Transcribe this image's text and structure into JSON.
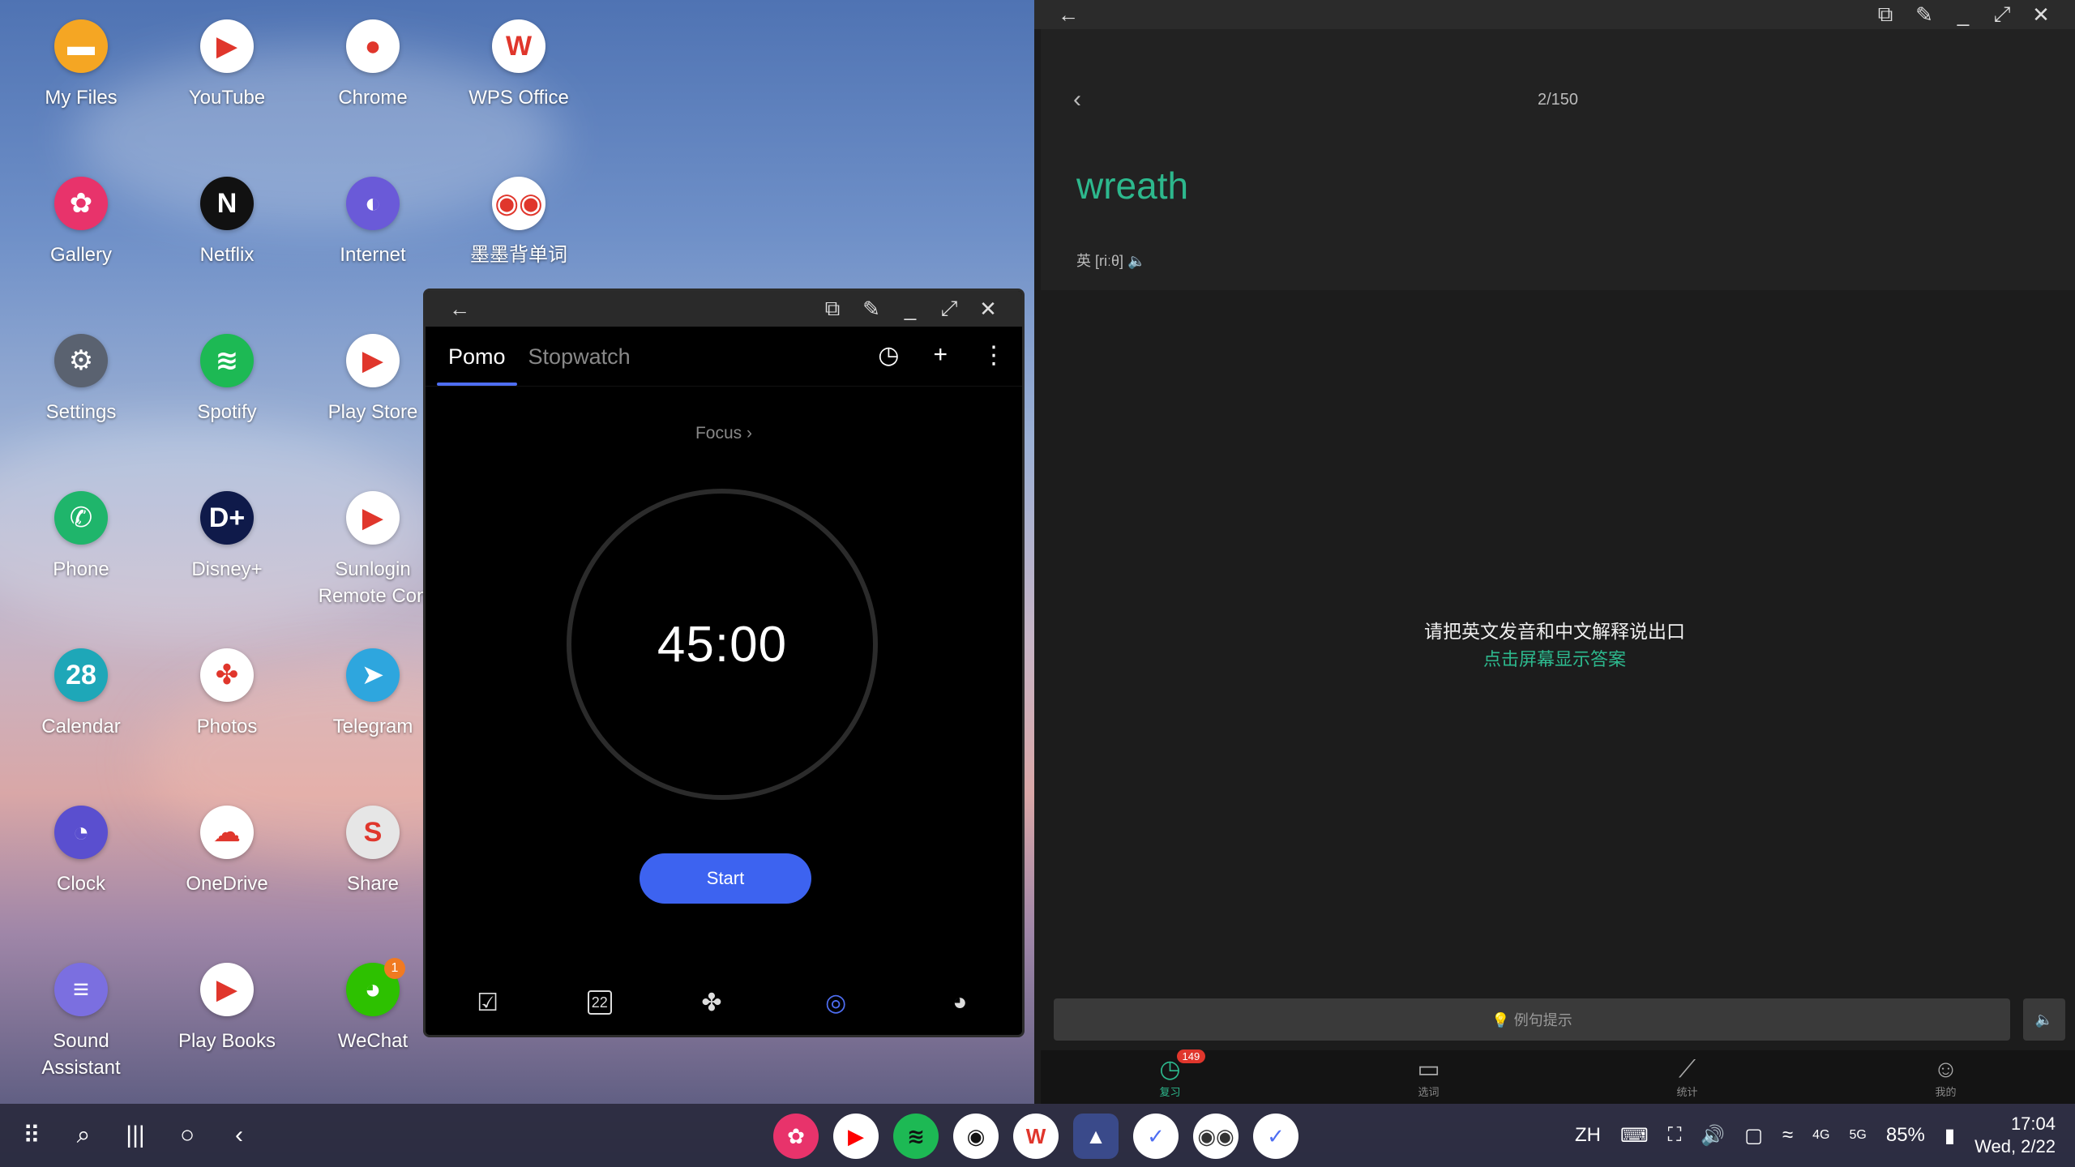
{
  "desktop": {
    "apps": [
      {
        "label": "My Files",
        "glyph": "▬",
        "bg": "#f5a623"
      },
      {
        "label": "YouTube",
        "glyph": "▶",
        "bg": "#ffffff"
      },
      {
        "label": "Chrome",
        "glyph": "●",
        "bg": "#ffffff"
      },
      {
        "label": "WPS Office",
        "glyph": "W",
        "bg": "#ffffff"
      },
      {
        "label": "Gallery",
        "glyph": "✿",
        "bg": "#e8336b"
      },
      {
        "label": "Netflix",
        "glyph": "N",
        "bg": "#111111"
      },
      {
        "label": "Internet",
        "glyph": "◐",
        "bg": "#6a5ad8"
      },
      {
        "label": "墨墨背单词",
        "glyph": "◉◉",
        "bg": "#ffffff"
      },
      {
        "label": "Settings",
        "glyph": "⚙",
        "bg": "#5a6270"
      },
      {
        "label": "Spotify",
        "glyph": "≋",
        "bg": "#1db954"
      },
      {
        "label": "Play Store",
        "glyph": "▶",
        "bg": "#ffffff"
      },
      {
        "label": "Phone",
        "glyph": "✆",
        "bg": "#1fb56b"
      },
      {
        "label": "Disney+",
        "glyph": "D+",
        "bg": "#0f1a4a"
      },
      {
        "label": "Sunlogin\nRemote Con",
        "glyph": "▶",
        "bg": "#ffffff"
      },
      {
        "label": "Calendar",
        "glyph": "28",
        "bg": "#1ea7b8"
      },
      {
        "label": "Photos",
        "glyph": "✤",
        "bg": "#ffffff"
      },
      {
        "label": "Telegram",
        "glyph": "➤",
        "bg": "#2ea6de"
      },
      {
        "label": "Clock",
        "glyph": "◔",
        "bg": "#5a4fcf"
      },
      {
        "label": "OneDrive",
        "glyph": "☁",
        "bg": "#ffffff"
      },
      {
        "label": "Share",
        "glyph": "S",
        "bg": "#e6e6e6"
      },
      {
        "label": "Sound\nAssistant",
        "glyph": "≡",
        "bg": "#7b6fe0"
      },
      {
        "label": "Play Books",
        "glyph": "▶",
        "bg": "#ffffff"
      },
      {
        "label": "WeChat",
        "glyph": "◕",
        "bg": "#2dc100",
        "badge": "1"
      }
    ]
  },
  "pomo": {
    "tabs": [
      "Pomo",
      "Stopwatch"
    ],
    "focus_label": "Focus ›",
    "time": "45:00",
    "start_label": "Start",
    "nav_icons": [
      "checkbox-icon",
      "calendar-icon",
      "grid-icon",
      "focus-icon",
      "clock-icon"
    ],
    "calendar_day": "22"
  },
  "vocab": {
    "counter": "2/150",
    "word": "wreath",
    "phonetic": "英 [riːθ] 🔈",
    "prompt": "请把英文发音和中文解释说出口",
    "reveal": "点击屏幕显示答案",
    "hint": "💡 例句提示",
    "nav": [
      {
        "label": "复习",
        "icon": "review-icon",
        "badge": "149"
      },
      {
        "label": "选词",
        "icon": "book-icon"
      },
      {
        "label": "统计",
        "icon": "chart-icon"
      },
      {
        "label": "我的",
        "icon": "profile-icon"
      }
    ]
  },
  "taskbar": {
    "lang": "ZH",
    "battery": "85%",
    "time": "17:04",
    "date": "Wed, 2/22",
    "signal_labels": [
      "4G",
      "5G"
    ]
  },
  "colors": {
    "accent": "#4e6ef2",
    "vocab_green": "#2db88d"
  }
}
